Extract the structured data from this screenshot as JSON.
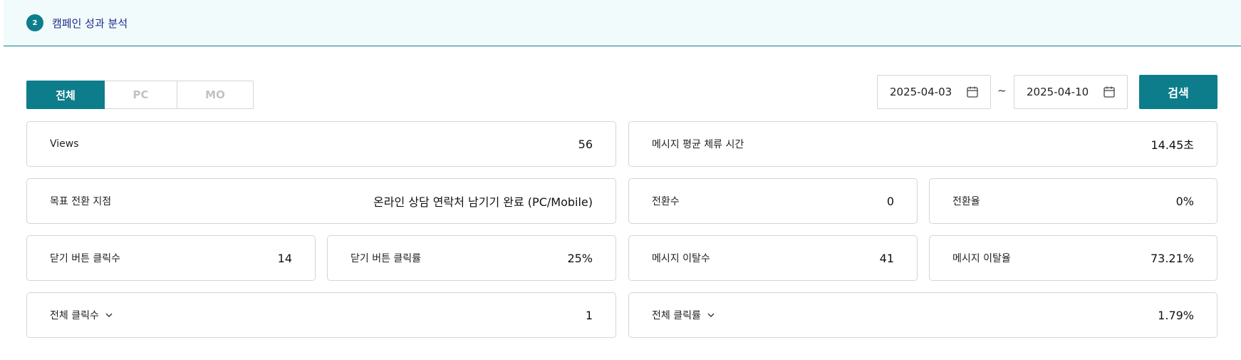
{
  "header": {
    "step": "2",
    "title": "캠페인 성과 분석"
  },
  "device_tabs": [
    {
      "label": "전체",
      "active": true
    },
    {
      "label": "PC",
      "active": false
    },
    {
      "label": "MO",
      "active": false
    }
  ],
  "date_range": {
    "start": "2025-04-03",
    "separator": "~",
    "end": "2025-04-10",
    "icon": "calendar-icon"
  },
  "search": {
    "label": "검색"
  },
  "metrics": {
    "views": {
      "label": "Views",
      "value": "56"
    },
    "avg_stay": {
      "label": "메시지 평균 체류 시간",
      "value": "14.45초"
    },
    "goal_point": {
      "label": "목표 전환 지점",
      "value": "온라인 상담 연락처 남기기 완료 (PC/Mobile)"
    },
    "conversions": {
      "label": "전환수",
      "value": "0"
    },
    "conversion_rate": {
      "label": "전환율",
      "value": "0%"
    },
    "close_clicks": {
      "label": "닫기 버튼 클릭수",
      "value": "14"
    },
    "close_click_rate": {
      "label": "닫기 버튼 클릭률",
      "value": "25%"
    },
    "bounces": {
      "label": "메시지 이탈수",
      "value": "41"
    },
    "bounce_rate": {
      "label": "메시지 이탈율",
      "value": "73.21%"
    },
    "total_clicks": {
      "label": "전체 클릭수",
      "value": "1"
    },
    "total_click_rate": {
      "label": "전체 클릭률",
      "value": "1.79%"
    }
  },
  "colors": {
    "accent": "#0d7d8c",
    "header_bg": "#f1fbfc",
    "title": "#1f2a8a",
    "border": "#d5d5d5"
  }
}
